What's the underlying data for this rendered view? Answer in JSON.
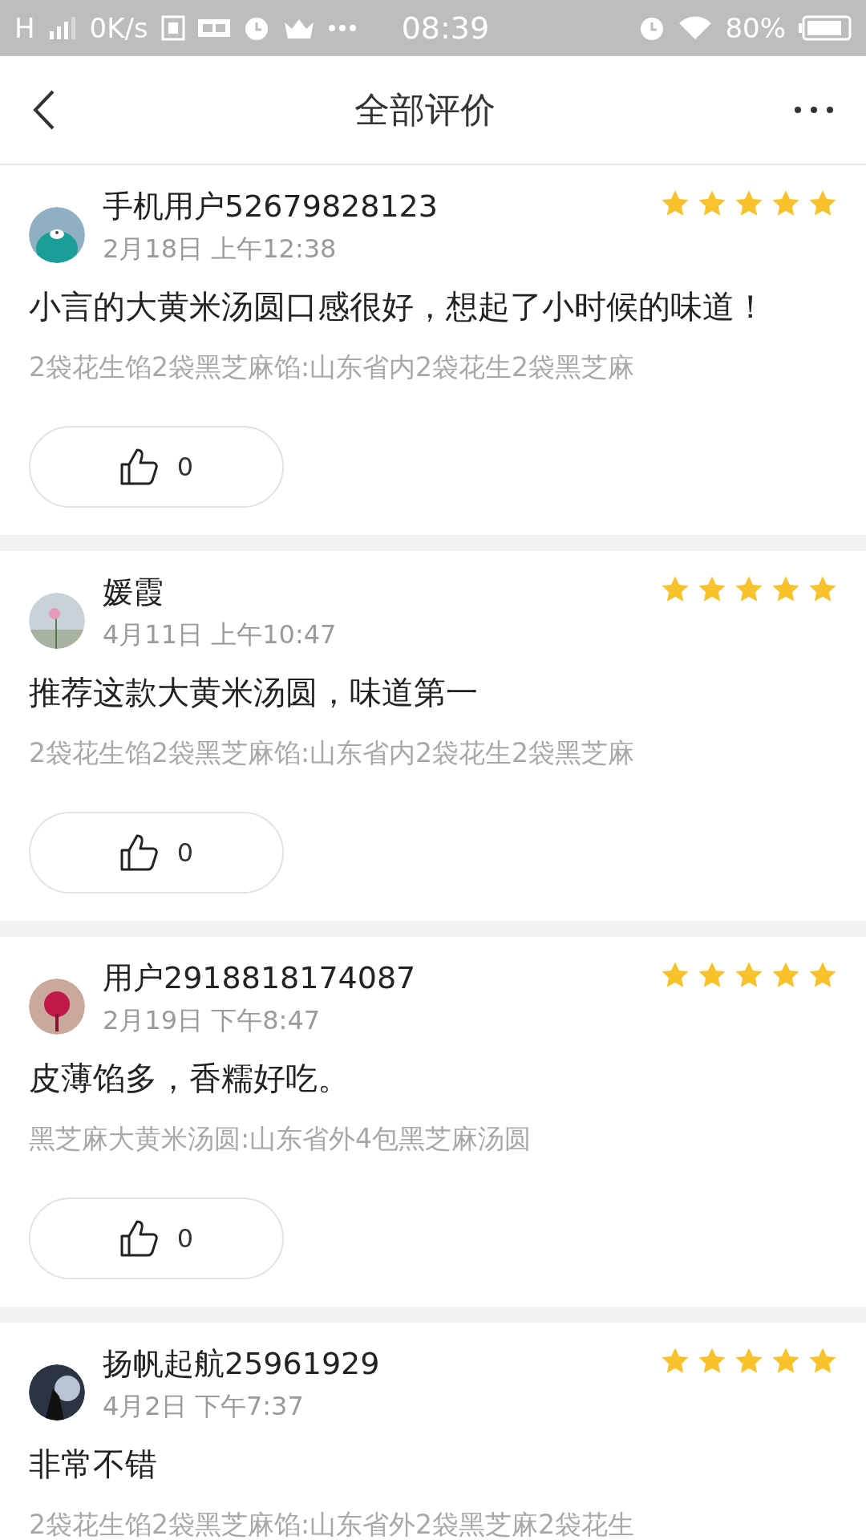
{
  "status_bar": {
    "network": "H",
    "speed": "0K/s",
    "time": "08:39",
    "battery": "80%"
  },
  "header": {
    "title": "全部评价"
  },
  "reviews": [
    {
      "user": "手机用户52679828123",
      "date": "2月18日 上午12:38",
      "stars": 5,
      "text": "小言的大黄米汤圆口感很好，想起了小时候的味道！",
      "variant": "2袋花生馅2袋黑芝麻馅:山东省内2袋花生2袋黑芝麻",
      "likes": "0"
    },
    {
      "user": "媛霞",
      "date": "4月11日 上午10:47",
      "stars": 5,
      "text": "推荐这款大黄米汤圆，味道第一",
      "variant": "2袋花生馅2袋黑芝麻馅:山东省内2袋花生2袋黑芝麻",
      "likes": "0"
    },
    {
      "user": "用户2918818174087",
      "date": "2月19日 下午8:47",
      "stars": 5,
      "text": "皮薄馅多，香糯好吃。",
      "variant": "黑芝麻大黄米汤圆:山东省外4包黑芝麻汤圆",
      "likes": "0"
    },
    {
      "user": "扬帆起航25961929",
      "date": "4月2日 下午7:37",
      "stars": 5,
      "text": "非常不错",
      "variant": "2袋花生馅2袋黑芝麻馅:山东省外2袋黑芝麻2袋花生"
    }
  ]
}
